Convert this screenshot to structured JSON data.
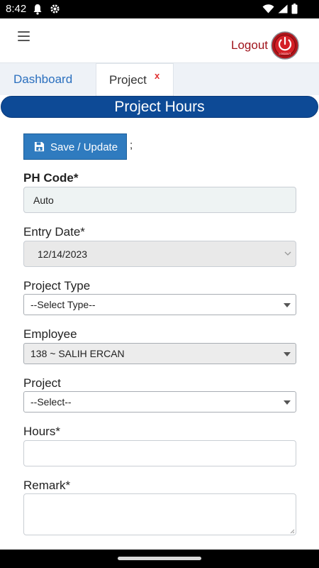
{
  "status_bar": {
    "time": "8:42",
    "left_icons": [
      "notification-bell-icon",
      "settings-gear-icon"
    ],
    "right_icons": [
      "wifi-icon",
      "signal-icon",
      "battery-icon"
    ]
  },
  "header": {
    "menu_icon": "hamburger-menu-icon",
    "logout_label": "Logout",
    "logout_icon": "power-button-icon",
    "logout_icon_text": "LOGOUT",
    "logout_color": "#a0141c"
  },
  "tabs": [
    {
      "label": "Dashboard",
      "active": false
    },
    {
      "label": "Project",
      "active": true,
      "close": "x"
    }
  ],
  "page_title": "Project Hours",
  "form": {
    "save_label": "Save / Update",
    "save_icon": "save-icon",
    "after_save_text": ";",
    "ph_code": {
      "label": "PH Code*",
      "value": "Auto"
    },
    "entry_date": {
      "label": "Entry Date*",
      "value": "12/14/2023"
    },
    "project_type": {
      "label": "Project Type",
      "value": "--Select Type--"
    },
    "employee": {
      "label": "Employee",
      "value": "138 ~ SALIH ERCAN"
    },
    "project": {
      "label": "Project",
      "value": "--Select--"
    },
    "hours": {
      "label": "Hours*",
      "value": ""
    },
    "remark": {
      "label": "Remark*",
      "value": ""
    }
  },
  "colors": {
    "title_bar": "#0d4a96",
    "save_button": "#2f7bbf",
    "tab_link": "#2a6fbe",
    "tab_close": "#e03030"
  }
}
